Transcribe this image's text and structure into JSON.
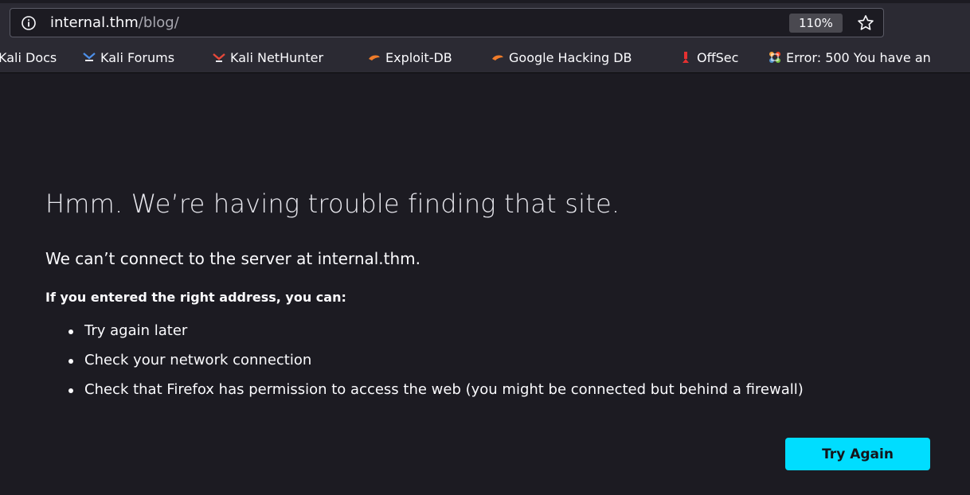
{
  "browser": {
    "url_host": "internal.thm",
    "url_path": "/blog/",
    "zoom": "110%"
  },
  "bookmarks": [
    {
      "label": "Kali Docs",
      "icon": "kali-docs-icon"
    },
    {
      "label": "Kali Forums",
      "icon": "kali-forums-icon"
    },
    {
      "label": "Kali NetHunter",
      "icon": "kali-nethunter-icon"
    },
    {
      "label": "Exploit-DB",
      "icon": "exploit-db-icon"
    },
    {
      "label": "Google Hacking DB",
      "icon": "ghdb-icon"
    },
    {
      "label": "OffSec",
      "icon": "offsec-icon"
    },
    {
      "label": "Error: 500 You have an",
      "icon": "joomla-icon"
    }
  ],
  "error_page": {
    "title": "Hmm. We’re having trouble finding that site.",
    "description": "We can’t connect to the server at internal.thm.",
    "subtitle": "If you entered the right address, you can:",
    "suggestions": [
      "Try again later",
      "Check your network connection",
      "Check that Firefox has permission to access the web (you might be connected but behind a firewall)"
    ],
    "button_label": "Try Again"
  },
  "colors": {
    "background": "#1c1b22",
    "toolbar": "#2b2a33",
    "accent_button": "#00ddff"
  }
}
